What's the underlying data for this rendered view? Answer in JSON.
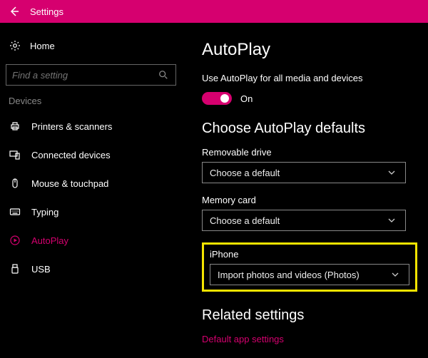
{
  "accent": "#d6006f",
  "titlebar": {
    "title": "Settings"
  },
  "sidebar": {
    "home_label": "Home",
    "search_placeholder": "Find a setting",
    "category_label": "Devices",
    "items": [
      {
        "label": "Printers & scanners"
      },
      {
        "label": "Connected devices"
      },
      {
        "label": "Mouse & touchpad"
      },
      {
        "label": "Typing"
      },
      {
        "label": "AutoPlay"
      },
      {
        "label": "USB"
      }
    ]
  },
  "content": {
    "page_title": "AutoPlay",
    "toggle_desc": "Use AutoPlay for all media and devices",
    "toggle_state_label": "On",
    "defaults_heading": "Choose AutoPlay defaults",
    "fields": {
      "removable": {
        "label": "Removable drive",
        "value": "Choose a default"
      },
      "memory": {
        "label": "Memory card",
        "value": "Choose a default"
      },
      "iphone": {
        "label": "iPhone",
        "value": "Import photos and videos (Photos)"
      }
    },
    "related_heading": "Related settings",
    "related_link": "Default app settings"
  }
}
